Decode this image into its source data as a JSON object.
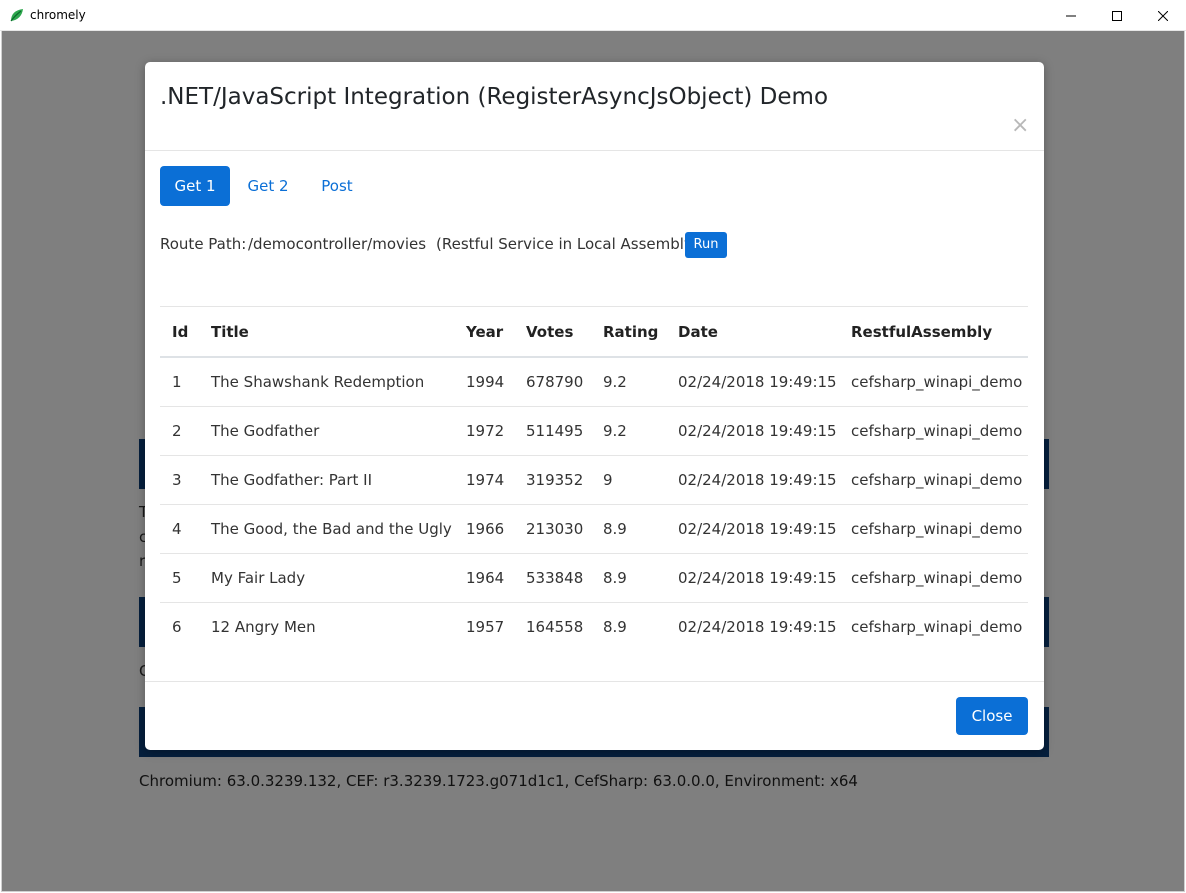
{
  "window": {
    "title": "chromely",
    "icon": "chromely-leaf-icon",
    "controls": [
      "minimize-icon",
      "maximize-icon",
      "close-icon"
    ]
  },
  "background": {
    "footer": "Chromium: 63.0.3239.132, CEF: r3.3239.1723.g071d1c1, CefSharp: 63.0.0.0, Environment: x64",
    "fragments": [
      "T",
      "c",
      "r",
      "C"
    ]
  },
  "modal": {
    "title": ".NET/JavaScript Integration (RegisterAsyncJsObject) Demo",
    "close_glyph": "×",
    "tabs": [
      {
        "label": "Get 1",
        "active": true
      },
      {
        "label": "Get 2",
        "active": false
      },
      {
        "label": "Post",
        "active": false
      }
    ],
    "route": {
      "label": "Route Path:",
      "path": "/democontroller/movies",
      "description": "(Restful Service in Local Assembly)",
      "run_label": "Run"
    },
    "table": {
      "columns": [
        "Id",
        "Title",
        "Year",
        "Votes",
        "Rating",
        "Date",
        "RestfulAssembly"
      ],
      "rows": [
        [
          "1",
          "The Shawshank Redemption",
          "1994",
          "678790",
          "9.2",
          "02/24/2018 19:49:15",
          "cefsharp_winapi_demo"
        ],
        [
          "2",
          "The Godfather",
          "1972",
          "511495",
          "9.2",
          "02/24/2018 19:49:15",
          "cefsharp_winapi_demo"
        ],
        [
          "3",
          "The Godfather: Part II",
          "1974",
          "319352",
          "9",
          "02/24/2018 19:49:15",
          "cefsharp_winapi_demo"
        ],
        [
          "4",
          "The Good, the Bad and the Ugly",
          "1966",
          "213030",
          "8.9",
          "02/24/2018 19:49:15",
          "cefsharp_winapi_demo"
        ],
        [
          "5",
          "My Fair Lady",
          "1964",
          "533848",
          "8.9",
          "02/24/2018 19:49:15",
          "cefsharp_winapi_demo"
        ],
        [
          "6",
          "12 Angry Men",
          "1957",
          "164558",
          "8.9",
          "02/24/2018 19:49:15",
          "cefsharp_winapi_demo"
        ]
      ]
    },
    "close_label": "Close"
  },
  "colors": {
    "primary": "#0b6fd6",
    "header_bar": "#0a3f7a",
    "overlay": "rgba(0,0,0,0.5)"
  }
}
